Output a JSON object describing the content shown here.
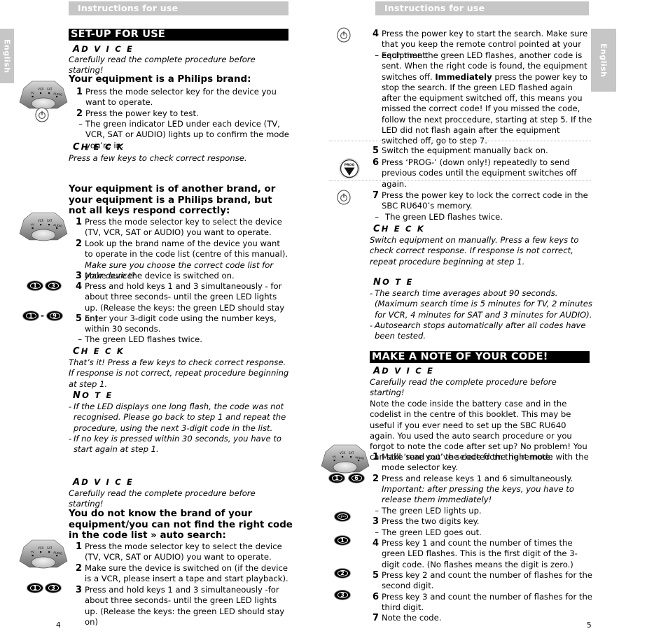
{
  "document": {
    "running_header": "Instructions for use",
    "language_tab": "English",
    "left_page_number": "4",
    "right_page_number": "5"
  },
  "left_page": {
    "banner": "SET-UP FOR USE",
    "advice_kicker": {
      "first": "A",
      "rest": "D V I C E"
    },
    "advice_text": "Carefully read the complete procedure before starting!",
    "section1": {
      "heading": "Your equipment is a Philips brand:",
      "steps": [
        {
          "num": "1",
          "text": "Press the mode selector key for the device you want to operate."
        },
        {
          "num": "2",
          "text": "Press the power key to test."
        },
        {
          "num": "–",
          "text": "The green indicator LED under each device (TV, VCR, SAT or AUDIO) lights up to confirm the mode you’re in."
        }
      ],
      "check_kicker": {
        "first": "C",
        "rest": "H E C K"
      },
      "check_text": "Press a few keys to check correct response."
    },
    "section2": {
      "heading": "Your equipment is of another brand, or your equipment is a Philips brand, but not all keys respond correctly:",
      "steps": [
        {
          "num": "1",
          "text": "Press the mode selector key to select the device (TV, VCR, SAT or AUDIO) you want to operate."
        },
        {
          "num": "2",
          "text": "Look up the brand name of the device you want to operate in the code list (centre of this manual)."
        },
        {
          "num": "",
          "text": "Make sure you choose the correct code list for your device!",
          "italic": true
        },
        {
          "num": "3",
          "text": "Make sure the device is switched on."
        },
        {
          "num": "4",
          "text": "Press and hold keys 1 and 3 simultaneously - for about three seconds- until the green LED lights up. (Release the keys: the green LED should stay on)"
        },
        {
          "num": "5",
          "text": "Enter your 3-digit code using the number keys, within 30 seconds."
        },
        {
          "num": "–",
          "text": "The green LED flashes twice."
        }
      ],
      "check_kicker": {
        "first": "C",
        "rest": "H E C K"
      },
      "check_text": "That’s it! Press a few keys to check correct response. If response is not correct, repeat procedure beginning at step 1.",
      "note_kicker": {
        "first": "N",
        "rest": "O T E"
      },
      "notes": [
        "If the LED displays one long flash, the code was not recognised. Please go back to step 1 and repeat the procedure, using the next 3-digit code in the list.",
        "If no key is pressed within 30 seconds, you have to start again at step 1."
      ]
    },
    "section3": {
      "advice_kicker": {
        "first": "A",
        "rest": "D V I C E"
      },
      "advice_text": "Carefully read the complete procedure before starting!",
      "heading": "You do not know the brand of your equipment/you can not find the right code in the code list » auto search:",
      "steps": [
        {
          "num": "1",
          "text": "Press the mode selector key to select the device (TV, VCR, SAT or AUDIO) you want to operate."
        },
        {
          "num": "2",
          "text": "Make sure the device is switched on (if the device is a VCR, please insert a tape and start playback)."
        },
        {
          "num": "3",
          "text": "Press and hold keys 1 and 3 simultaneously -for about three seconds- until the green LED lights up. (Release the keys: the green LED should stay on)"
        }
      ]
    },
    "key_icons": {
      "one": "1",
      "three": "3",
      "nine": "9",
      "range_separator": "-"
    }
  },
  "right_page": {
    "autosearch_steps": [
      {
        "num": "4",
        "text": "Press the power key to start the search. Make sure that you keep the remote control pointed at your equipment."
      },
      {
        "num": "–",
        "text": "Each time the green LED flashes, another code is sent. When the right code is found, the equipment switches off. Immediately press the power key to stop the search. If the green LED flashed again after the equipment switched off, this means you missed the correct code! If you missed the code, follow the next proccedure, starting at step 5. If the LED did not flash again after the equipment switched off, go to step 7.",
        "bold_word": "Immediately"
      },
      {
        "num": "5",
        "text": "Switch the equipment manually back on."
      },
      {
        "num": "6",
        "text": "Press ‘PROG-’ (down only!) repeatedly to send previous codes until the equipment switches off again."
      },
      {
        "num": "7",
        "text": "Press the power key to lock the correct code in the SBC RU640’s memory."
      },
      {
        "num": "–",
        "text": "The green LED flashes twice."
      }
    ],
    "check_kicker": {
      "first": "C",
      "rest": "H E C K"
    },
    "check_text": "Switch equipment on manually. Press a few keys to check correct response. If response is not correct, repeat procedure beginning at step 1.",
    "note_kicker": {
      "first": "N",
      "rest": "O T E"
    },
    "notes": [
      "The search time averages about 90 seconds. (Maximum search time is 5 minutes for TV, 2 minutes for VCR, 4 minutes for SAT and 3 minutes for AUDIO).",
      "Autosearch stops automatically after all codes have been tested."
    ],
    "banner": "MAKE A NOTE OF YOUR CODE!",
    "advice_kicker": {
      "first": "A",
      "rest": "D V I C E"
    },
    "advice_text": "Carefully read the complete procedure before starting!",
    "intro_paragraph": "Note the code inside the battery case and in the codelist in the centre of this booklet. This may be useful if you ever need to set up the SBC RU640 again. You used the auto search procedure or you forgot to note the code after set up? No problem! You can still ‘read out’ the code from the remote:",
    "readout_steps": [
      {
        "num": "1",
        "text": "Make sure you’ve selected the right mode with the mode selector key."
      },
      {
        "num": "2",
        "text": "Press and release keys 1 and 6 simultaneously."
      },
      {
        "num": "",
        "text": "Important: after pressing the keys, you have to release them immediately!",
        "italic": true
      },
      {
        "num": "–",
        "text": "The green LED lights up."
      },
      {
        "num": "3",
        "text": "Press the two digits key."
      },
      {
        "num": "–",
        "text": "The green LED goes out."
      },
      {
        "num": "4",
        "text": "Press key 1 and count the number of times the green LED flashes. This is the first digit of the 3-digit code. (No flashes means the digit is zero.)"
      },
      {
        "num": "5",
        "text": "Press key 2 and count the number of flashes for the second digit."
      },
      {
        "num": "6",
        "text": "Press key 3 and count the number of flashes for the third digit."
      },
      {
        "num": "7",
        "text": "Note the code."
      }
    ],
    "key_icons": {
      "one": "1",
      "two": "2",
      "three": "3",
      "six": "6",
      "two_digits": "-/--",
      "prog_label": "PROG"
    }
  },
  "remote_labels": {
    "tv": "TV",
    "vcr": "VCR",
    "sat": "SAT",
    "audio": "AUDIO"
  },
  "colors": {
    "header_gray": "#c6c6c6",
    "banner_black": "#000000",
    "text_black": "#000000",
    "rule_gray": "#b9b9b9"
  }
}
